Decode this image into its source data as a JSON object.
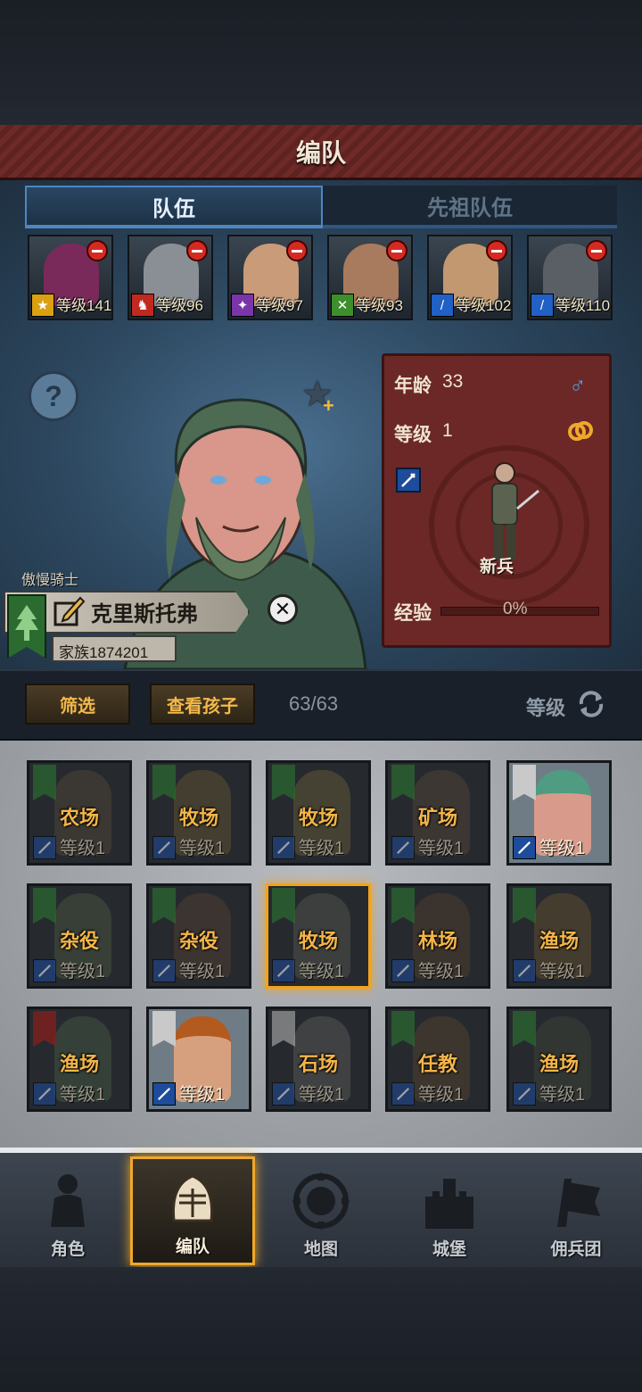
{
  "header": {
    "title": "编队"
  },
  "tabs": [
    {
      "label": "队伍",
      "active": true
    },
    {
      "label": "先祖队伍",
      "active": false
    }
  ],
  "team": [
    {
      "level": "等级141",
      "face": "#7a2a5a",
      "badge": "#d9a012"
    },
    {
      "level": "等级96",
      "face": "#8a8f95",
      "badge": "#c0291f"
    },
    {
      "level": "等级97",
      "face": "#c99b78",
      "badge": "#7a35a8"
    },
    {
      "level": "等级93",
      "face": "#a87a5e",
      "badge": "#3d8f2c"
    },
    {
      "level": "等级102",
      "face": "#c29870",
      "badge": "#2160c4"
    },
    {
      "level": "等级110",
      "face": "#5a5f66",
      "badge": "#2160c4"
    }
  ],
  "character": {
    "title_label": "傲慢骑士",
    "name": "克里斯托弗",
    "family": "家族1874201",
    "age_label": "年龄",
    "age": "33",
    "level_label": "等级",
    "level": "1",
    "class_name": "新兵",
    "exp_label": "经验",
    "exp_percent": "0%",
    "gender_icon": "♂"
  },
  "toolbar": {
    "filter_label": "筛选",
    "children_label": "查看孩子",
    "count": "63/63",
    "sort_label": "等级"
  },
  "grid": [
    {
      "job": "农场",
      "level": "等级1",
      "bright": false,
      "banner": "green"
    },
    {
      "job": "牧场",
      "level": "等级1",
      "bright": false,
      "banner": "green"
    },
    {
      "job": "牧场",
      "level": "等级1",
      "bright": false,
      "banner": "green"
    },
    {
      "job": "矿场",
      "level": "等级1",
      "bright": false,
      "banner": "green"
    },
    {
      "job": "",
      "level": "等级1",
      "bright": true,
      "banner": "grey"
    },
    {
      "job": "杂役",
      "level": "等级1",
      "bright": false,
      "banner": "green"
    },
    {
      "job": "杂役",
      "level": "等级1",
      "bright": false,
      "banner": "green"
    },
    {
      "job": "牧场",
      "level": "等级1",
      "bright": false,
      "banner": "green",
      "selected": true
    },
    {
      "job": "林场",
      "level": "等级1",
      "bright": false,
      "banner": "green"
    },
    {
      "job": "渔场",
      "level": "等级1",
      "bright": false,
      "banner": "green"
    },
    {
      "job": "渔场",
      "level": "等级1",
      "bright": false,
      "banner": "red"
    },
    {
      "job": "",
      "level": "等级1",
      "bright": true,
      "banner": "grey"
    },
    {
      "job": "石场",
      "level": "等级1",
      "bright": false,
      "banner": "grey"
    },
    {
      "job": "任教",
      "level": "等级1",
      "bright": false,
      "banner": "green"
    },
    {
      "job": "渔场",
      "level": "等级1",
      "bright": false,
      "banner": "green"
    }
  ],
  "nav": [
    {
      "label": "角色",
      "active": false
    },
    {
      "label": "编队",
      "active": true
    },
    {
      "label": "地图",
      "active": false
    },
    {
      "label": "城堡",
      "active": false
    },
    {
      "label": "佣兵团",
      "active": false
    }
  ],
  "colors": {
    "accent_gold": "#f1a31e",
    "panel_red": "#6b2826",
    "tab_blue": "#4e86c0"
  }
}
